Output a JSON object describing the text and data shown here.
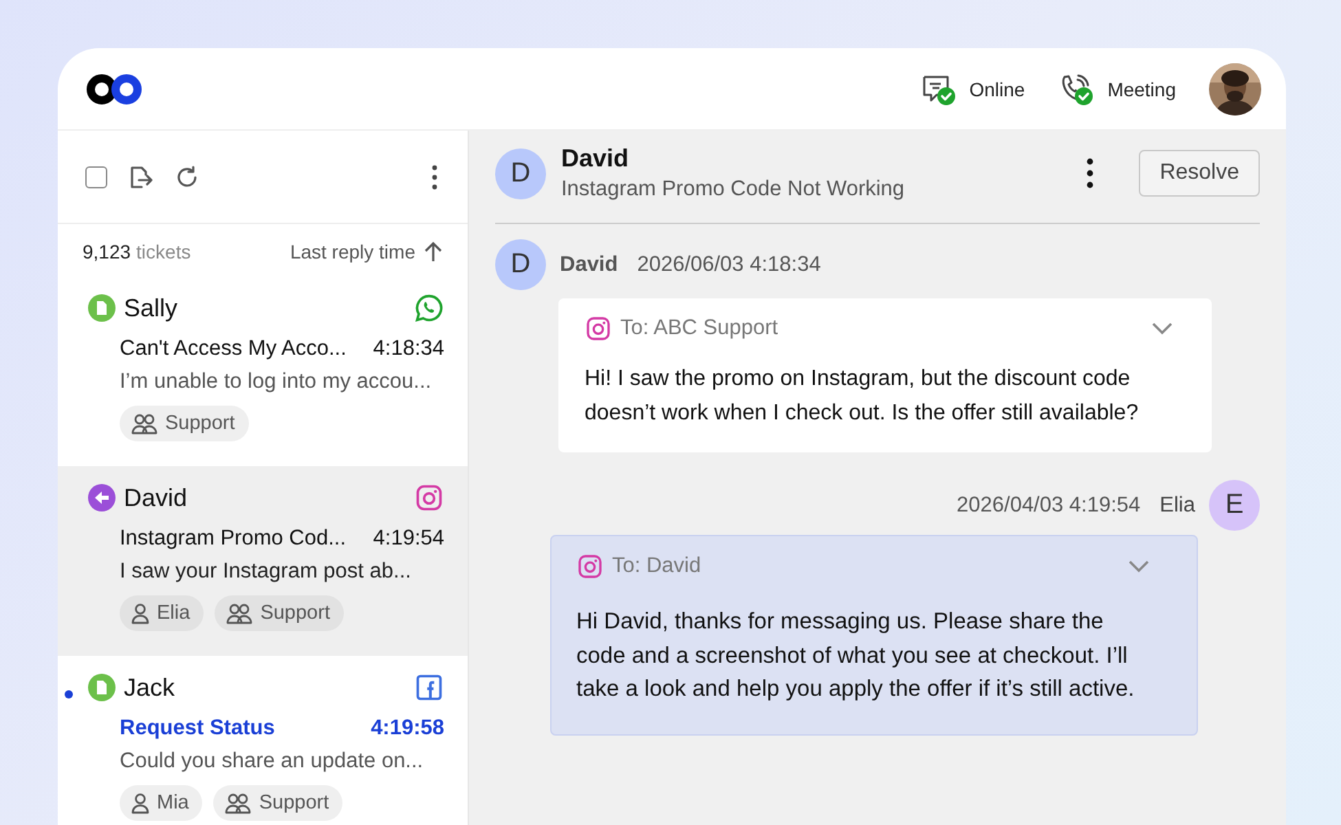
{
  "header": {
    "statuses": [
      {
        "kind": "chat",
        "label": "Online"
      },
      {
        "kind": "phone",
        "label": "Meeting"
      }
    ]
  },
  "toolbar": {
    "select_all": {
      "checked": false
    }
  },
  "list": {
    "count": "9,123",
    "count_label": "tickets",
    "sort": "Last reply time"
  },
  "tickets": [
    {
      "status_icon": {
        "kind": "document"
      },
      "name": "Sally",
      "channel_icon": {
        "kind": "whatsapp"
      },
      "subject": "Can't Access My Acco...",
      "time": "4:18:34",
      "preview": "I’m unable to log into my accou...",
      "selected": false,
      "unread": false,
      "tags": [
        {
          "kind": "team",
          "label": "Support"
        }
      ]
    },
    {
      "status_icon": {
        "kind": "reply"
      },
      "name": "David",
      "channel_icon": {
        "kind": "instagram"
      },
      "subject": "Instagram Promo Cod...",
      "time": "4:19:54",
      "preview": "I saw your Instagram post ab...",
      "selected": true,
      "unread": false,
      "tags": [
        {
          "kind": "agent",
          "label": "Elia"
        },
        {
          "kind": "team",
          "label": "Support"
        }
      ]
    },
    {
      "status_icon": {
        "kind": "document"
      },
      "name": "Jack",
      "channel_icon": {
        "kind": "facebook"
      },
      "subject": "Request Status",
      "time": "4:19:58",
      "preview": "Could you share an update on...",
      "selected": false,
      "unread": true,
      "tags": [
        {
          "kind": "agent",
          "label": "Mia"
        },
        {
          "kind": "team",
          "label": "Support"
        }
      ]
    }
  ],
  "conversation": {
    "avatar": "D",
    "name": "David",
    "subject": "Instagram Promo Code Not Working",
    "action": "Resolve"
  },
  "messages": [
    {
      "kind": "incoming",
      "avatar": "D",
      "sender": "David",
      "time": "2026/06/03 4:18:34",
      "channel_icon": {
        "kind": "instagram"
      },
      "to": "To: ABC Support",
      "body": "Hi! I saw the promo on Instagram, but the discount code doesn’t work when I check out. Is the offer still available?"
    },
    {
      "kind": "outgoing",
      "avatar": "E",
      "sender": "Elia",
      "time": "2026/04/03 4:19:54",
      "channel_icon": {
        "kind": "instagram"
      },
      "to": "To: David",
      "body": "Hi David, thanks for messaging us. Please share the code and a screenshot of what you see at checkout. I’ll take a look and help you apply the offer if it’s still active."
    }
  ]
}
